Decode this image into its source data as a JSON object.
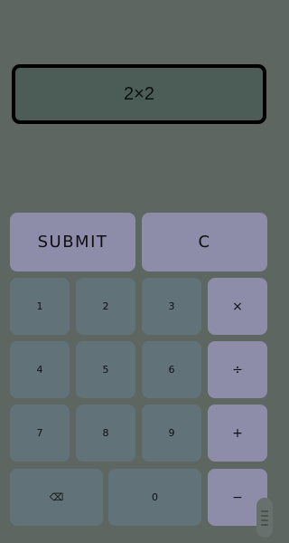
{
  "display": {
    "expression": "2×2"
  },
  "actions": {
    "submit": "SUBMIT",
    "clear": "C"
  },
  "keys": {
    "one": "1",
    "two": "2",
    "three": "3",
    "four": "4",
    "five": "5",
    "six": "6",
    "seven": "7",
    "eight": "8",
    "nine": "9",
    "zero": "0",
    "backspace": "⌫",
    "multiply": "×",
    "divide": "÷",
    "plus": "+",
    "minus": "−"
  },
  "colors": {
    "background": "#5e6661",
    "display_bg": "#4b5d56",
    "number_key": "#617378",
    "operator_key": "#8e8da9"
  }
}
